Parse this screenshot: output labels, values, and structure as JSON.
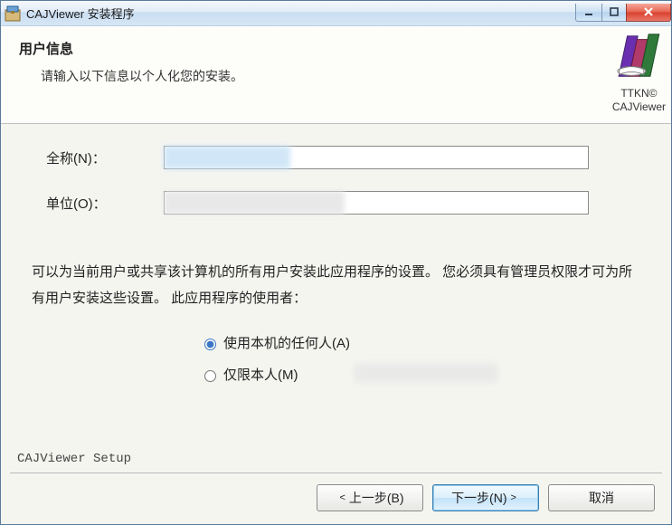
{
  "window": {
    "title": "CAJViewer 安装程序"
  },
  "header": {
    "title": "用户信息",
    "subtitle": "请输入以下信息以个人化您的安装。",
    "brand_top": "TTKN©",
    "brand_bottom": "CAJViewer"
  },
  "fields": {
    "fullname_label": "全称(N)：",
    "fullname_value": "",
    "org_label": "单位(O)：",
    "org_value": ""
  },
  "description": "可以为当前用户或共享该计算机的所有用户安装此应用程序的设置。 您必须具有管理员权限才可为所有用户安装这些设置。 此应用程序的使用者：",
  "radios": {
    "anyone": "使用本机的任何人(A)",
    "onlyme": "仅限本人(M)",
    "selected": "anyone"
  },
  "footer": {
    "brand": "CAJViewer Setup",
    "back": "上一步(B)",
    "next": "下一步(N)",
    "cancel": "取消"
  }
}
